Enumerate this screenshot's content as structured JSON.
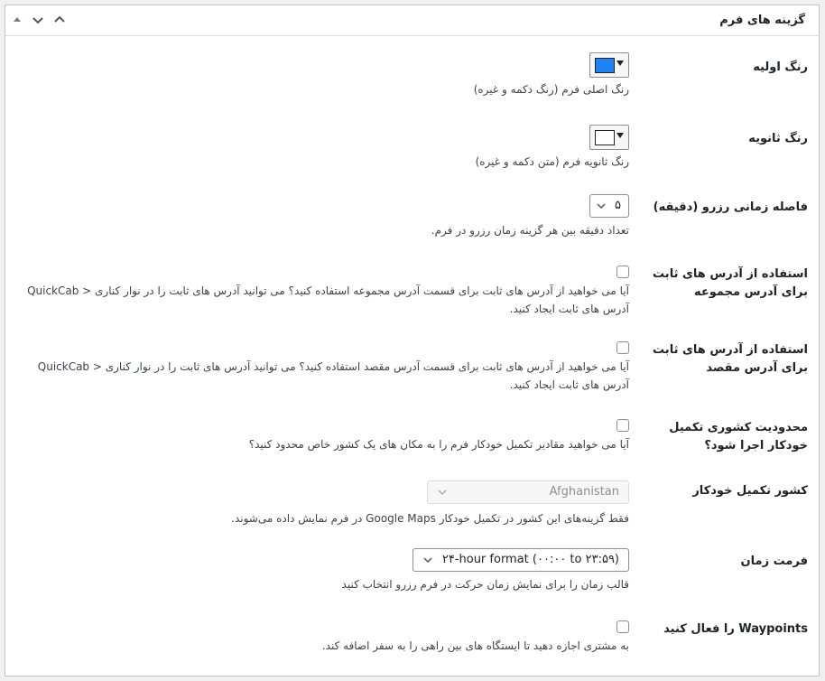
{
  "panel": {
    "title": "گزینه های فرم"
  },
  "fields": {
    "primary_color": {
      "label": "رنگ اولیه",
      "color": "#1e82f0",
      "description": "رنگ اصلی فرم (رنگ دکمه و غیره)"
    },
    "secondary_color": {
      "label": "رنگ ثانویه",
      "color": "#ffffff",
      "description": "رنگ ثانویه فرم (متن دکمه و غیره)"
    },
    "booking_interval": {
      "label": "فاصله زمانی رزرو (دقیقه)",
      "value": "۵",
      "description": "تعداد دقیقه بین هر گزینه زمان رزرو در فرم."
    },
    "fixed_pickup": {
      "label": "استفاده از آدرس های ثابت برای آدرس مجموعه",
      "description": "آیا می خواهید از آدرس های ثابت برای قسمت آدرس مجموعه استفاده کنید؟ می توانید آدرس های ثابت را در نوار کناری < QuickCab آدرس های ثابت ایجاد کنید."
    },
    "fixed_destination": {
      "label": "استفاده از آدرس های ثابت برای آدرس مقصد",
      "description": "آیا می خواهید از آدرس های ثابت برای قسمت آدرس مقصد استفاده کنید؟ می توانید آدرس های ثابت را در نوار کناری < QuickCab آدرس های ثابت ایجاد کنید."
    },
    "country_restrict": {
      "label": "محدودیت کشوری تکمیل خودکار اجرا شود؟",
      "description": "آیا می خواهید مقادیر تکمیل خودکار فرم را به مکان های یک کشور خاص محدود کنید؟"
    },
    "autocomplete_country": {
      "label": "کشور تکمیل خودکار",
      "value": "Afghanistan",
      "description": "فقط گزینه‌های این کشور در تکمیل خودکار Google Maps در فرم نمایش داده می‌شوند."
    },
    "time_format": {
      "label": "فرمت زمان",
      "value": "۲۴-hour format (۰۰:۰۰ to ۲۳:۵۹)",
      "description": "قالب زمان را برای نمایش زمان حرکت در فرم رزرو انتخاب کنید"
    },
    "waypoints": {
      "label": "Waypoints را فعال کنید",
      "description": "به مشتری اجازه دهید تا ایستگاه های بین راهی را به سفر اضافه کند."
    }
  }
}
